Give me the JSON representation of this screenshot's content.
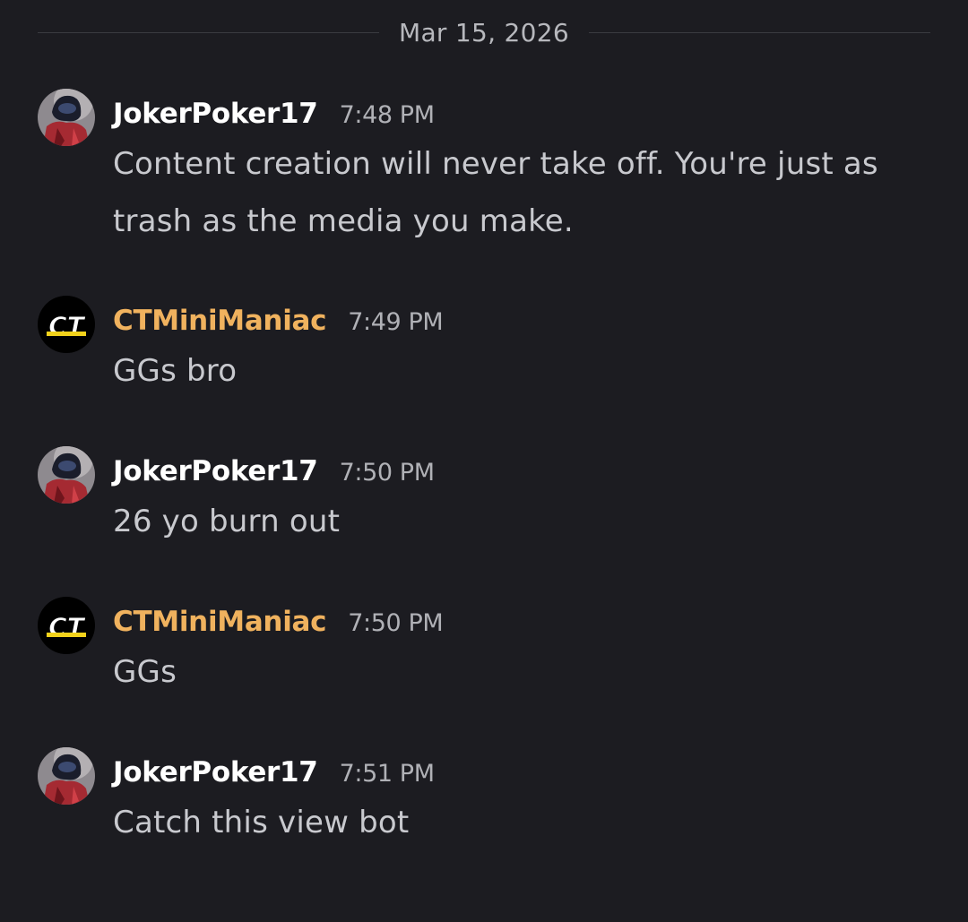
{
  "date_divider": "Mar 15, 2026",
  "messages": [
    {
      "author": "JokerPoker17",
      "time": "7:48 PM",
      "text": "Content creation will never take off. You're just as trash as the media you make.",
      "avatar_icon": "red-hooded-character-avatar-icon"
    },
    {
      "author": "CTMiniManiac",
      "time": "7:49 PM",
      "text": "GGs bro",
      "avatar_icon": "ct-logo-avatar-icon"
    },
    {
      "author": "JokerPoker17",
      "time": "7:50 PM",
      "text": "26 yo burn out",
      "avatar_icon": "red-hooded-character-avatar-icon"
    },
    {
      "author": "CTMiniManiac",
      "time": "7:50 PM",
      "text": "GGs",
      "avatar_icon": "ct-logo-avatar-icon"
    },
    {
      "author": "JokerPoker17",
      "time": "7:51 PM",
      "text": "Catch this view bot",
      "avatar_icon": "red-hooded-character-avatar-icon"
    }
  ],
  "avatars": {
    "ct_logo_text": "CT"
  },
  "colors": {
    "background": "#1c1c21",
    "joker_name": "#ffffff",
    "ct_name": "#f0b25e",
    "message_text": "#c8c9ce",
    "timestamp": "#b0b1b6",
    "divider": "#3a3b41"
  }
}
